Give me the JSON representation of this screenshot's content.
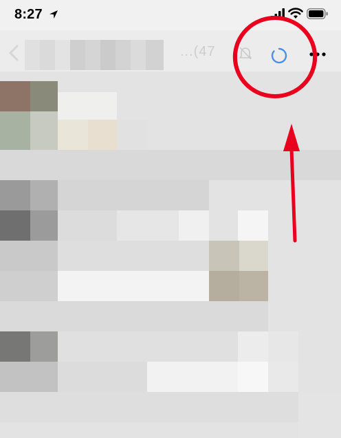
{
  "status_bar": {
    "time": "8:27",
    "location_icon": "location-arrow-icon",
    "signal_icon": "cellular-signal-icon",
    "wifi_icon": "wifi-icon",
    "battery_icon": "battery-icon"
  },
  "nav_bar": {
    "back_icon": "chevron-left-icon",
    "title_partial": "...(47",
    "mute_icon": "bell-slash-icon",
    "refresh_icon": "refresh-spinner-icon",
    "more_icon": "more-dots-icon"
  },
  "colors": {
    "annotation_red": "#e8001e",
    "accent_blue": "#4a90e2",
    "status_bar_bg": "#f1f1f1",
    "nav_bar_bg": "#ececec"
  },
  "annotations": {
    "circle": "red-highlight-circle",
    "arrow": "red-pointer-arrow"
  }
}
